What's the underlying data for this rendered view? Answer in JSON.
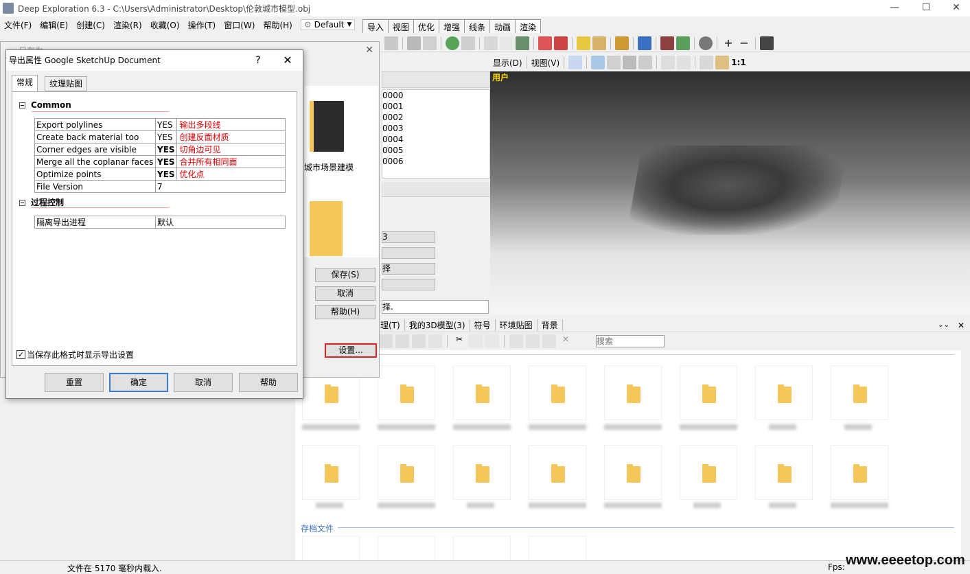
{
  "window": {
    "title": "Deep Exploration 6.3 - C:\\Users\\Administrator\\Desktop\\伦敦城市模型.obj"
  },
  "menu": {
    "items": [
      "文件(F)",
      "编辑(E)",
      "创建(C)",
      "渲染(R)",
      "收藏(O)",
      "操作(T)",
      "窗口(W)",
      "帮助(H)"
    ],
    "preset": "Default"
  },
  "tabs": [
    "导入",
    "视图",
    "优化",
    "增强",
    "线条",
    "动画",
    "渲染"
  ],
  "viewToolbar": {
    "display": "显示(D)",
    "view": "视图(V)",
    "ratio": "1:1"
  },
  "viewport": {
    "label": "用户"
  },
  "fileList": [
    "0000",
    "0001",
    "0002",
    "0003",
    "0004",
    "0005",
    "0006"
  ],
  "backDialog": {
    "title": "另存为",
    "folderCaption": "城市场景建模",
    "save": "保存(S)",
    "cancel": "取消",
    "help": "帮助(H)",
    "settings": "设置...",
    "panelFragments": [
      "3",
      "",
      "择",
      ""
    ],
    "hint": "择."
  },
  "dialog": {
    "title": "导出属性 Google SketchUp Document",
    "help": "?",
    "tabs": [
      "常规",
      "纹理贴图"
    ],
    "groups": [
      {
        "name": "Common"
      },
      {
        "name": "过程控制"
      }
    ],
    "commonProps": [
      {
        "key": "Export polylines",
        "value": "YES",
        "note": "输出多段线",
        "bold": false
      },
      {
        "key": "Create back material too",
        "value": "YES",
        "note": "创建反面材质",
        "bold": false
      },
      {
        "key": "Corner edges are visible",
        "value": "YES",
        "note": "切角边可见",
        "bold": true
      },
      {
        "key": "Merge all the coplanar faces",
        "value": "YES",
        "note": "合并所有相同面",
        "bold": true
      },
      {
        "key": "Optimize points",
        "value": "YES",
        "note": "优化点",
        "bold": true
      },
      {
        "key": "File Version",
        "value": "7",
        "note": "",
        "bold": false
      }
    ],
    "processProps": [
      {
        "key": "隔离导出进程",
        "value": "默认"
      }
    ],
    "checkbox": {
      "label": "当保存此格式时显示导出设置",
      "checked": true
    },
    "buttons": {
      "reset": "重置",
      "ok": "确定",
      "cancel": "取消",
      "help": "帮助"
    }
  },
  "browser": {
    "tabs": [
      "理(T)",
      "我的3D模型(3)",
      "符号",
      "环境贴图",
      "背景"
    ],
    "searchPlaceholder": "搜索",
    "archiveSection": "存档文件"
  },
  "status": {
    "message": "文件在 5170 毫秒内载入.",
    "fps": "Fps:"
  },
  "watermark": "www.eeeetop.com",
  "colors": {
    "accent": "#3a7bd5",
    "noteRed": "#e00000",
    "viewportLabel": "#ffd700",
    "folder": "#f5c75a"
  }
}
